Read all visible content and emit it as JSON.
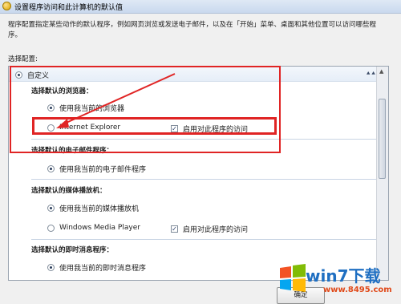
{
  "window": {
    "title": "设置程序访问和此计算机的默认值"
  },
  "description": "程序配置指定某些动作的默认程序，例如网页浏览或发送电子邮件，以及在「开始」菜单、桌面和其他位置可以访问哪些程序。",
  "config_label": "选择配置:",
  "panel": {
    "header": "自定义",
    "browser": {
      "title": "选择默认的浏览器：",
      "use_current": "使用我当前的浏览器",
      "ie": "Internet Explorer",
      "enable_access": "启用对此程序的访问"
    },
    "email": {
      "title": "选择默认的电子邮件程序：",
      "use_current": "使用我当前的电子邮件程序"
    },
    "media": {
      "title": "选择默认的媒体播放机：",
      "use_current": "使用我当前的媒体播放机",
      "wmp": "Windows Media Player",
      "enable_access": "启用对此程序的访问"
    },
    "im": {
      "title": "选择默认的即时消息程序：",
      "use_current": "使用我当前的即时消息程序"
    }
  },
  "buttons": {
    "ok": "确定"
  },
  "watermark": {
    "brand": "win7下载",
    "url": "www.8495.com"
  },
  "colors": {
    "annotation": "#e02424",
    "brand": "#1f6fc2"
  }
}
